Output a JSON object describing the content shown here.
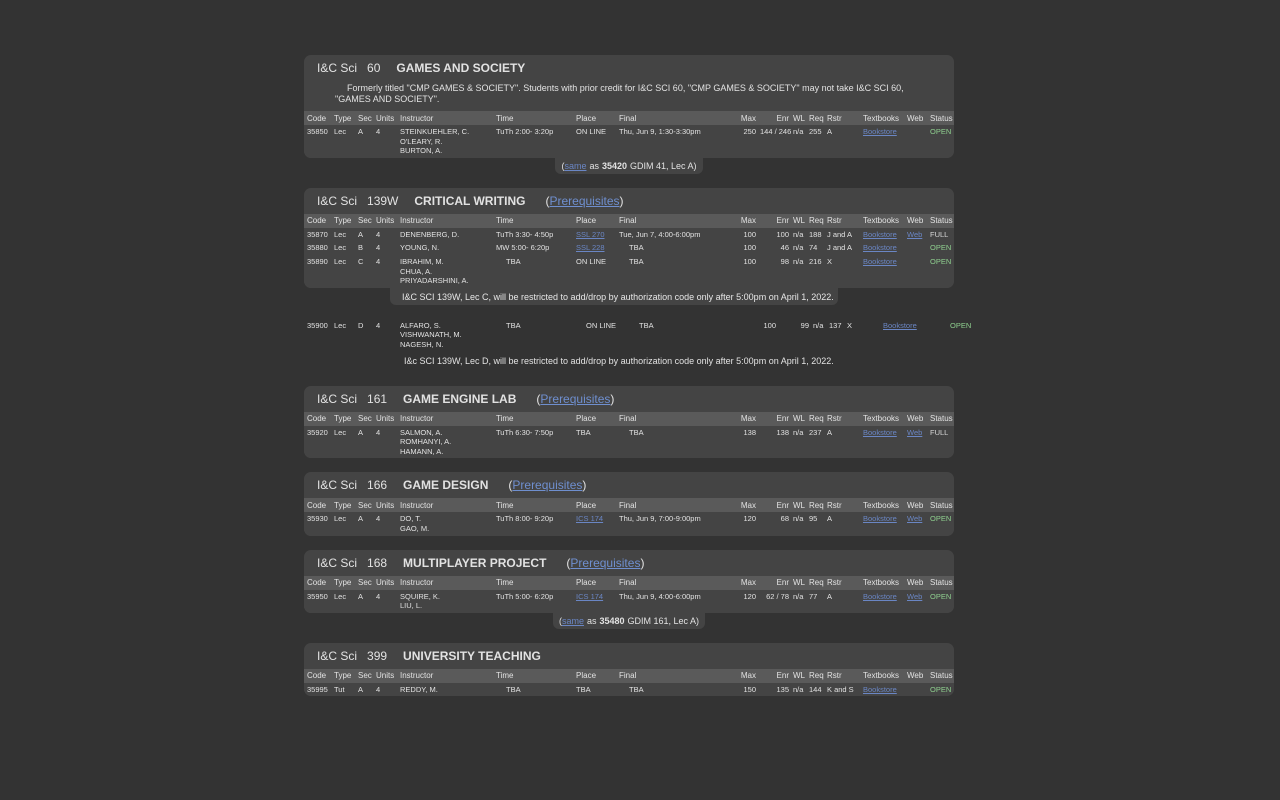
{
  "headers": [
    "Code",
    "Type",
    "Sec",
    "Units",
    "Instructor",
    "Time",
    "Place",
    "Final",
    "Max",
    "Enr",
    "WL",
    "Req",
    "Rstr",
    "Textbooks",
    "Web",
    "Status"
  ],
  "courses": [
    {
      "dept": "I&C Sci",
      "num": "60",
      "title": "GAMES AND SOCIETY",
      "comment": "Formerly titled \"CMP GAMES & SOCIETY\". Students with prior credit for I&C SCI 60, \"CMP GAMES & SOCIETY\" may not take I&C SCI 60, \"GAMES AND SOCIETY\".",
      "rows": [
        {
          "code": "35850",
          "type": "Lec",
          "sec": "A",
          "units": "4",
          "instructor": [
            "STEINKUEHLER, C.",
            "O'LEARY, R.",
            "BURTON, A."
          ],
          "time": "TuTh   2:00- 3:20p",
          "place": "ON LINE",
          "final": "Thu, Jun 9, 1:30-3:30pm",
          "max": "250",
          "enr": "144 / 246",
          "wl": "n/a",
          "req": "255",
          "rstr": "A",
          "textbooks": "Bookstore",
          "web": "",
          "status": "OPEN"
        }
      ],
      "same": {
        "open": "(",
        "link": "same",
        "as": "as",
        "code": "35420",
        "rest": "GDIM 41, Lec A)"
      }
    },
    {
      "dept": "I&C Sci",
      "num": "139W",
      "title": "CRITICAL WRITING",
      "prereq": "Prerequisites",
      "rows": [
        {
          "code": "35870",
          "type": "Lec",
          "sec": "A",
          "units": "4",
          "instructor": [
            "DENENBERG, D."
          ],
          "time": "TuTh   3:30- 4:50p",
          "place": "SSL 270",
          "final": "Tue, Jun 7, 4:00-6:00pm",
          "max": "100",
          "enr": "100",
          "wl": "n/a",
          "req": "188",
          "rstr": "J and A",
          "textbooks": "Bookstore",
          "web": "Web",
          "status": "FULL"
        },
        {
          "code": "35880",
          "type": "Lec",
          "sec": "B",
          "units": "4",
          "instructor": [
            "YOUNG, N."
          ],
          "time": "MW   5:00- 6:20p",
          "place": "SSL 228",
          "final": "TBA",
          "max": "100",
          "enr": "46",
          "wl": "n/a",
          "req": "74",
          "rstr": "J and A",
          "textbooks": "Bookstore",
          "web": "",
          "status": "OPEN"
        },
        {
          "code": "35890",
          "type": "Lec",
          "sec": "C",
          "units": "4",
          "instructor": [
            "IBRAHIM, M.",
            "CHUA, A.",
            "PRIYADARSHINI, A."
          ],
          "time": "TBA",
          "place": "ON LINE",
          "final": "TBA",
          "max": "100",
          "enr": "98",
          "wl": "n/a",
          "req": "216",
          "rstr": "X",
          "textbooks": "Bookstore",
          "web": "",
          "status": "OPEN"
        },
        {
          "code": "35900",
          "type": "Lec",
          "sec": "D",
          "units": "4",
          "instructor": [
            "ALFARO, S.",
            "VISHWANATH, M.",
            "NAGESH, N."
          ],
          "time": "TBA",
          "place": "ON LINE",
          "final": "TBA",
          "max": "100",
          "enr": "99",
          "wl": "n/a",
          "req": "137",
          "rstr": "X",
          "textbooks": "Bookstore",
          "web": "",
          "status": "OPEN"
        }
      ],
      "note_c": "I&C SCI 139W, Lec C, will be restricted to add/drop by authorization code only after 5:00pm on April 1, 2022.",
      "note_d": "I&c SCI 139W, Lec D, will be restricted to add/drop by authorization code only after 5:00pm on April 1, 2022."
    },
    {
      "dept": "I&C Sci",
      "num": "161",
      "title": "GAME ENGINE LAB",
      "prereq": "Prerequisites",
      "rows": [
        {
          "code": "35920",
          "type": "Lec",
          "sec": "A",
          "units": "4",
          "instructor": [
            "SALMON, A.",
            "ROMHANYI, A.",
            "HAMANN, A."
          ],
          "time": "TuTh   6:30- 7:50p",
          "place": "TBA",
          "final": "TBA",
          "max": "138",
          "enr": "138",
          "wl": "n/a",
          "req": "237",
          "rstr": "A",
          "textbooks": "Bookstore",
          "web": "Web",
          "status": "FULL"
        }
      ]
    },
    {
      "dept": "I&C Sci",
      "num": "166",
      "title": "GAME DESIGN",
      "prereq": "Prerequisites",
      "rows": [
        {
          "code": "35930",
          "type": "Lec",
          "sec": "A",
          "units": "4",
          "instructor": [
            "DO, T.",
            "GAO, M."
          ],
          "time": "TuTh   8:00- 9:20p",
          "place": "ICS 174",
          "final": "Thu, Jun 9, 7:00-9:00pm",
          "max": "120",
          "enr": "68",
          "wl": "n/a",
          "req": "95",
          "rstr": "A",
          "textbooks": "Bookstore",
          "web": "Web",
          "status": "OPEN"
        }
      ]
    },
    {
      "dept": "I&C Sci",
      "num": "168",
      "title": "MULTIPLAYER PROJECT",
      "prereq": "Prerequisites",
      "rows": [
        {
          "code": "35950",
          "type": "Lec",
          "sec": "A",
          "units": "4",
          "instructor": [
            "SQUIRE, K.",
            "LIU, L."
          ],
          "time": "TuTh   5:00- 6:20p",
          "place": "ICS 174",
          "final": "Thu, Jun 9, 4:00-6:00pm",
          "max": "120",
          "enr": "62 / 78",
          "wl": "n/a",
          "req": "77",
          "rstr": "A",
          "textbooks": "Bookstore",
          "web": "Web",
          "status": "OPEN"
        }
      ],
      "same": {
        "open": "(",
        "link": "same",
        "as": "as",
        "code": "35480",
        "rest": "GDIM 161, Lec A)"
      }
    },
    {
      "dept": "I&C Sci",
      "num": "399",
      "title": "UNIVERSITY TEACHING",
      "rows": [
        {
          "code": "35995",
          "type": "Tut",
          "sec": "A",
          "units": "4",
          "instructor": [
            "REDDY, M."
          ],
          "time": "TBA",
          "place": "TBA",
          "final": "TBA",
          "max": "150",
          "enr": "135",
          "wl": "n/a",
          "req": "144",
          "rstr": "K and S",
          "textbooks": "Bookstore",
          "web": "",
          "status": "OPEN"
        }
      ]
    }
  ],
  "colors": {
    "background": "#333333",
    "panel": "#444444",
    "header_row": "#5a5a5a",
    "link": "#6a86c4",
    "open": "#8fd08f"
  }
}
